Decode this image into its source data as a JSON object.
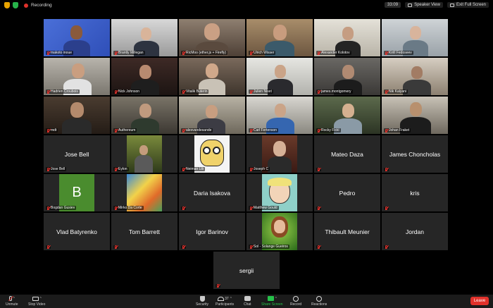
{
  "status": {
    "recording_label": "Recording",
    "timer": "33:09"
  },
  "top_buttons": {
    "speaker_view": "Speaker View",
    "exit_full_screen": "Exit Full Screen"
  },
  "participants": [
    "makoto inoue",
    "Brantly Millegan",
    "RicMoo (ether.js + Firefly)",
    "Ulrich Wisser",
    "Alexander Kolotov",
    "Kirill Fedoseev",
    "Hadrien Croubois",
    "Nick Johnson",
    "Vitalik Buterin",
    "Julien Niset",
    "james.montgomery",
    "Nik Kalyani",
    "mdt",
    "Authereum",
    "alexvandesande",
    "Carl Fertenson",
    "Rocky Fickl",
    "Johan Fraket",
    "Jose Bell",
    "Eylon",
    "Neiman Lib",
    "Joseph C",
    "Mateo Daza",
    "James Choncholas",
    "Bogdan Gusiev",
    "Mirko Da Corte",
    "Daria Isakova",
    "Matthew Gould",
    "Pedro",
    "kris",
    "Vlad Batyrenko",
    "Tom Barrett",
    "Igor Barinov",
    "Sol - Solange Gueiros",
    "Thibault Meunier",
    "Jordan",
    "sergii"
  ],
  "avatar_letter_bogdan": "B",
  "toolbar": {
    "unmute": "Unmute",
    "stop_video": "Stop Video",
    "security": "Security",
    "participants": "Participants",
    "participants_count": "37",
    "chat": "Chat",
    "share_screen": "Share Screen",
    "record": "Record",
    "reactions": "Reactions",
    "leave": "Leave"
  },
  "colors": {
    "active_speaker": "#c7f24a",
    "muted": "#e0312b",
    "share": "#26c24a",
    "leave": "#e0312b"
  }
}
